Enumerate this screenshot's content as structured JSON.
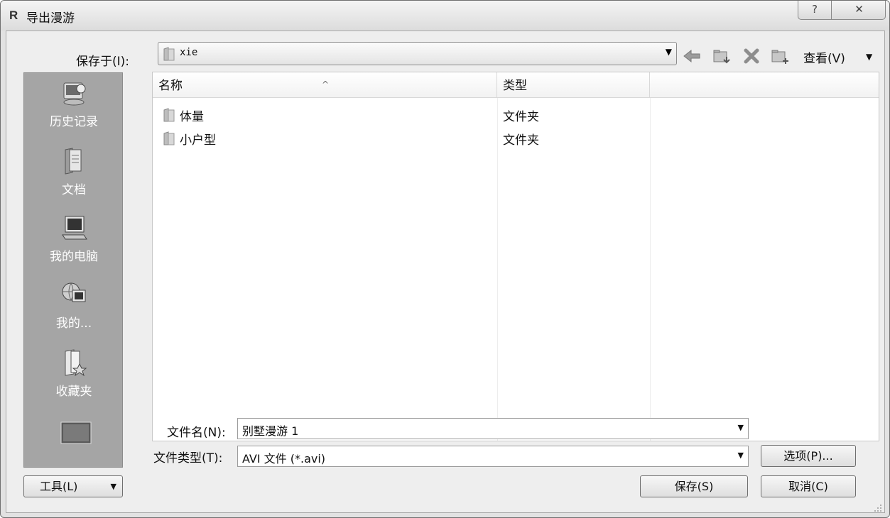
{
  "window": {
    "app_icon_letter": "R",
    "title": "导出漫游",
    "help_glyph": "?",
    "close_glyph": "✕"
  },
  "location": {
    "label": "保存于(I):",
    "value": "xie"
  },
  "toolbar": {
    "view_label": "查看(V)",
    "icons": [
      "back-arrow-icon",
      "up-folder-icon",
      "delete-icon",
      "new-folder-icon",
      "view-menu-icon"
    ]
  },
  "places": [
    {
      "label": "历史记录",
      "icon": "history-icon"
    },
    {
      "label": "文档",
      "icon": "documents-icon"
    },
    {
      "label": "我的电脑",
      "icon": "computer-icon"
    },
    {
      "label": "我的...",
      "icon": "network-icon"
    },
    {
      "label": "收藏夹",
      "icon": "favorites-icon"
    },
    {
      "label": "",
      "icon": "desktop-icon"
    }
  ],
  "filelist": {
    "columns": [
      "名称",
      "类型",
      ""
    ],
    "rows": [
      {
        "name": "体量",
        "type": "文件夹"
      },
      {
        "name": "小户型",
        "type": "文件夹"
      }
    ]
  },
  "filename": {
    "label": "文件名(N):",
    "value": "别墅漫游 1"
  },
  "filetype": {
    "label": "文件类型(T):",
    "value": "AVI 文件 (*.avi)"
  },
  "buttons": {
    "options": "选项(P)...",
    "tools": "工具(L)",
    "save": "保存(S)",
    "cancel": "取消(C)"
  },
  "colors": {
    "places_bg": "#a5a5a5",
    "folder": "#c8c8c8",
    "dialog_bg": "#eeeeee"
  }
}
